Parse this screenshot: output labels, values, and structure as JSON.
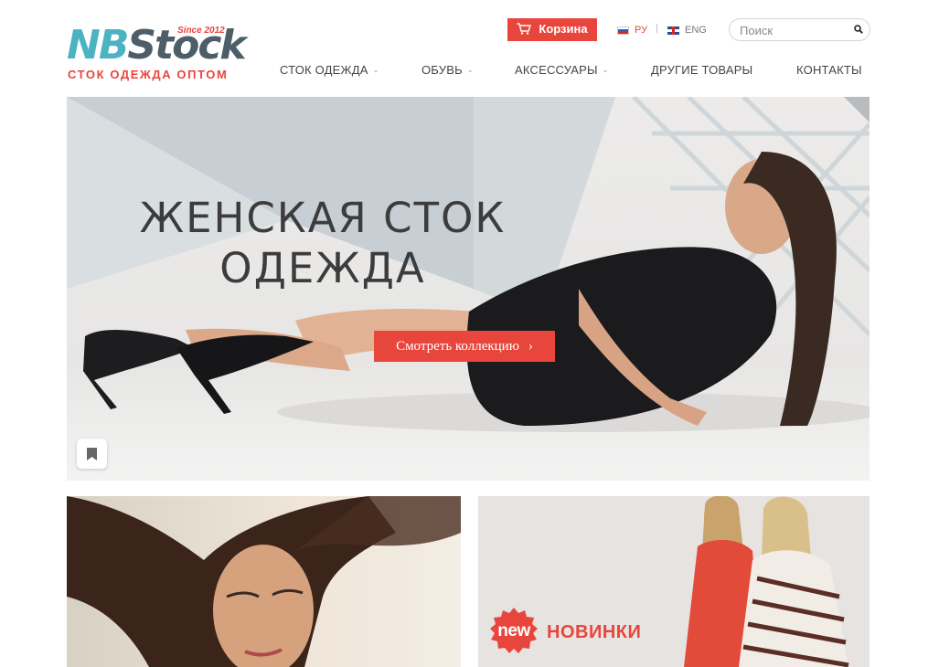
{
  "logo": {
    "brand_part1": "NB",
    "brand_part2": "Stock",
    "since": "Since 2012",
    "tagline": "СТОК ОДЕЖДА ОПТОМ"
  },
  "header": {
    "cart_label": "Корзина",
    "lang_ru": "РУ",
    "lang_separator": "|",
    "lang_en": "ENG",
    "search_placeholder": "Поиск"
  },
  "nav": {
    "items": [
      {
        "label": "СТОК ОДЕЖДА",
        "has_dropdown": true
      },
      {
        "label": "ОБУВЬ",
        "has_dropdown": true
      },
      {
        "label": "АКСЕССУАРЫ",
        "has_dropdown": true
      },
      {
        "label": "ДРУГИЕ ТОВАРЫ",
        "has_dropdown": false
      },
      {
        "label": "КОНТАКТЫ",
        "has_dropdown": false
      }
    ]
  },
  "hero": {
    "title_line1": "ЖЕНСКАЯ СТОК",
    "title_line2": "ОДЕЖДА",
    "cta_label": "Смотреть коллекцию",
    "cta_arrow": "›"
  },
  "banners": {
    "right_badge": "new",
    "right_label": "НОВИНКИ"
  },
  "colors": {
    "accent": "#e8463c",
    "brand_teal": "#4bb3c2",
    "brand_dark": "#4d5e68"
  },
  "icons": [
    "cart-icon",
    "flag-ru-icon",
    "flag-uk-icon",
    "search-icon",
    "chevron-down-icon",
    "chevron-right-icon",
    "bookmark-icon",
    "new-badge-icon"
  ]
}
